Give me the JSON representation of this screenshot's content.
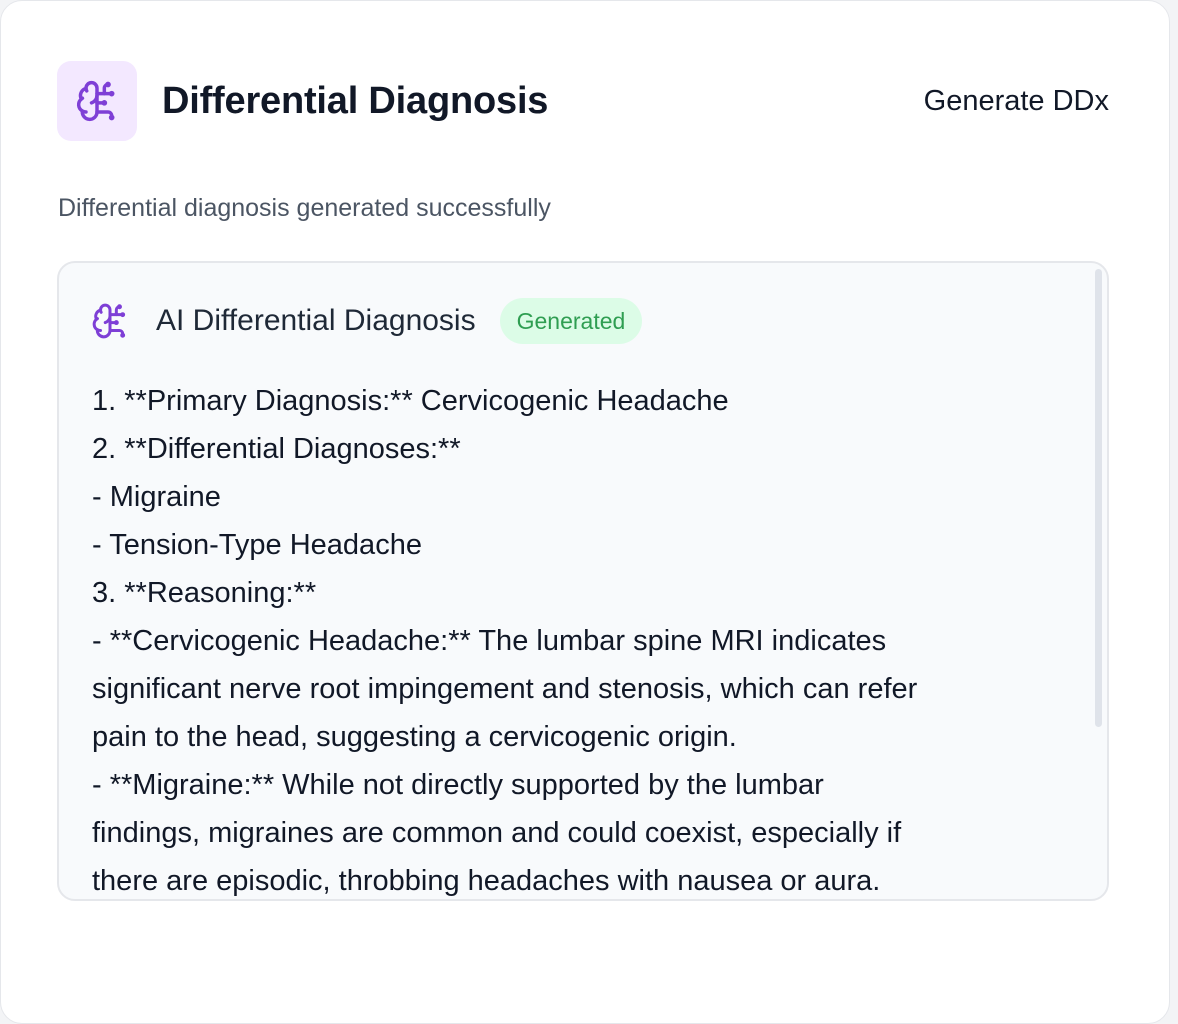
{
  "header": {
    "title": "Differential Diagnosis",
    "icon": "brain-icon",
    "generate_label": "Generate DDx"
  },
  "status_message": "Differential diagnosis generated successfully",
  "result": {
    "title": "AI Differential Diagnosis",
    "icon": "brain-icon",
    "badge": "Generated",
    "lines": [
      "1. **Primary Diagnosis:** Cervicogenic Headache",
      "2. **Differential Diagnoses:**",
      "- Migraine",
      "- Tension-Type Headache",
      "3. **Reasoning:**",
      "- **Cervicogenic Headache:** The lumbar spine MRI indicates",
      "significant nerve root impingement and stenosis, which can refer",
      "pain to the head, suggesting a cervicogenic origin.",
      "- **Migraine:** While not directly supported by the lumbar",
      "findings, migraines are common and could coexist, especially if",
      "there are episodic, throbbing headaches with nausea or aura."
    ]
  },
  "colors": {
    "accent": "#7e3fd6",
    "icon_bg": "#f3e8ff",
    "badge_bg": "#dcfce7",
    "badge_text": "#2f9e52"
  }
}
